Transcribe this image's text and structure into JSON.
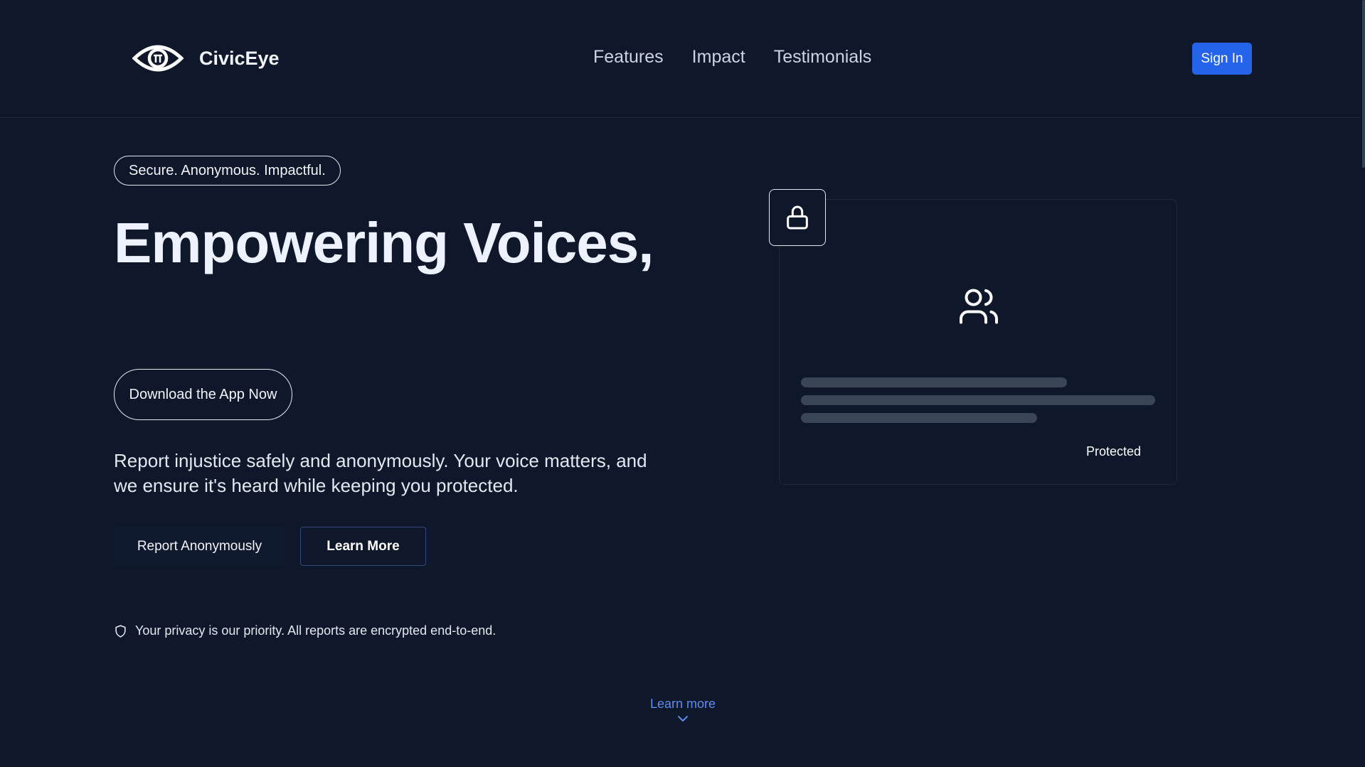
{
  "header": {
    "brand": "CivicEye",
    "brand_icon": "eye-icon",
    "nav": [
      {
        "label": "Features"
      },
      {
        "label": "Impact"
      },
      {
        "label": "Testimonials"
      }
    ],
    "signin_label": "Sign In"
  },
  "hero": {
    "badge": "Secure. Anonymous. Impactful.",
    "headline": "Empowering Voices,",
    "download_label": "Download the App Now",
    "description": "Report injustice safely and anonymously. Your voice matters, and we ensure it's heard while keeping you protected.",
    "report_label": "Report Anonymously",
    "learn_label": "Learn More",
    "privacy_icon": "shield-icon",
    "privacy_note": "Your privacy is our priority. All reports are encrypted end-to-end."
  },
  "card": {
    "lock_icon": "lock-icon",
    "users_icon": "users-icon",
    "status": "Protected"
  },
  "footer_hint": {
    "label": "Learn more",
    "icon": "chevron-down-icon"
  },
  "colors": {
    "background": "#0f172a",
    "accent": "#2563eb",
    "link": "#5b8def"
  }
}
